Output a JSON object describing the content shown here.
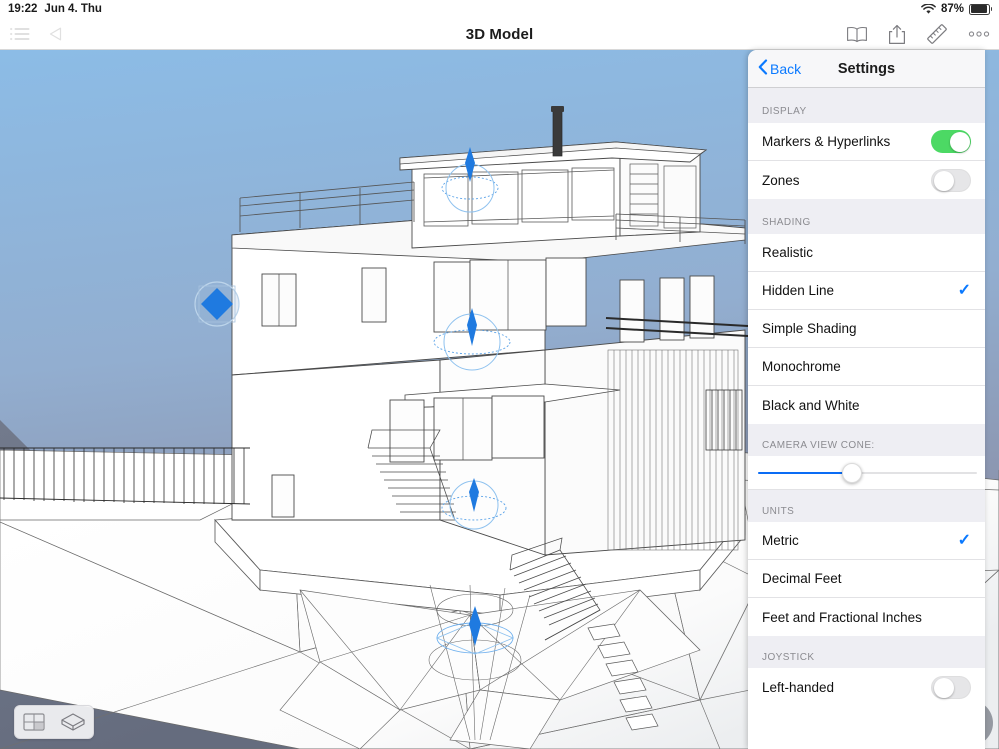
{
  "status_bar": {
    "time": "19:22",
    "date": "Jun 4. Thu",
    "battery_percent": "87%",
    "wifi_icon": "wifi-icon",
    "battery_icon": "battery-icon"
  },
  "toolbar": {
    "title": "3D Model",
    "left_icons": [
      {
        "name": "list-menu-icon",
        "label": "Navigator"
      },
      {
        "name": "back-arrow-icon",
        "label": "Back"
      }
    ],
    "right_icons": [
      {
        "name": "book-icon",
        "label": "Library"
      },
      {
        "name": "share-icon",
        "label": "Share"
      },
      {
        "name": "ruler-icon",
        "label": "Measure"
      },
      {
        "name": "more-dots-icon",
        "label": "More"
      }
    ]
  },
  "viewport": {
    "model_name": "3D Model",
    "shading_mode": "Hidden Line",
    "sky_top_color": "#8cb8e0",
    "sky_bottom_color": "#8a94ae",
    "marker_color": "#2a7fe8",
    "ground_color": "#6e7689"
  },
  "bottom_bar": {
    "items": [
      {
        "name": "layout-panel-icon",
        "label": "Layout"
      },
      {
        "name": "3d-model-icon",
        "label": "3D Model"
      }
    ]
  },
  "walk_button": {
    "name": "walk-mode-icon",
    "label": "Walk"
  },
  "settings": {
    "back_label": "Back",
    "title": "Settings",
    "sections": [
      {
        "header": "DISPLAY",
        "type": "toggles",
        "rows": [
          {
            "label": "Markers & Hyperlinks",
            "state": "on"
          },
          {
            "label": "Zones",
            "state": "off"
          }
        ]
      },
      {
        "header": "SHADING",
        "type": "options",
        "rows": [
          {
            "label": "Realistic",
            "selected": false
          },
          {
            "label": "Hidden Line",
            "selected": true
          },
          {
            "label": "Simple Shading",
            "selected": false
          },
          {
            "label": "Monochrome",
            "selected": false
          },
          {
            "label": "Black and White",
            "selected": false
          }
        ]
      },
      {
        "header": "CAMERA VIEW CONE:",
        "type": "slider",
        "value_percent": 43
      },
      {
        "header": "UNITS",
        "type": "options",
        "rows": [
          {
            "label": "Metric",
            "selected": true
          },
          {
            "label": "Decimal Feet",
            "selected": false
          },
          {
            "label": "Feet and Fractional Inches",
            "selected": false
          }
        ]
      },
      {
        "header": "JOYSTICK",
        "type": "toggles",
        "rows": [
          {
            "label": "Left-handed",
            "state": "off"
          }
        ]
      }
    ],
    "checkmark_glyph": "✓",
    "accent_color": "#0a79ff",
    "toggle_on_color": "#4cd964"
  }
}
